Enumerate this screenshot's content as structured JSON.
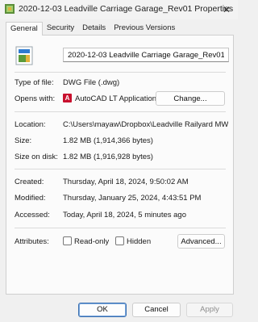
{
  "window": {
    "title": "2020-12-03 Leadville Carriage Garage_Rev01 Properties",
    "close_glyph": "✕"
  },
  "tabs": [
    {
      "label": "General",
      "active": true
    },
    {
      "label": "Security"
    },
    {
      "label": "Details"
    },
    {
      "label": "Previous Versions"
    }
  ],
  "general": {
    "file_name": "2020-12-03 Leadville Carriage Garage_Rev01",
    "type_label": "Type of file:",
    "type_value": "DWG File (.dwg)",
    "opens_label": "Opens with:",
    "opens_value": "AutoCAD LT Application",
    "opens_icon_glyph": "A",
    "change_button": "Change...",
    "location_label": "Location:",
    "location_value": "C:\\Users\\mayaw\\Dropbox\\Leadville Railyard MWK\\C",
    "size_label": "Size:",
    "size_value": "1.82 MB (1,914,366 bytes)",
    "size_disk_label": "Size on disk:",
    "size_disk_value": "1.82 MB (1,916,928 bytes)",
    "created_label": "Created:",
    "created_value": "Thursday, April 18, 2024, 9:50:02 AM",
    "modified_label": "Modified:",
    "modified_value": "Thursday, January 25, 2024, 4:43:51 PM",
    "accessed_label": "Accessed:",
    "accessed_value": "Today, April 18, 2024, 5 minutes ago",
    "attributes_label": "Attributes:",
    "readonly_label": "Read-only",
    "hidden_label": "Hidden",
    "advanced_button": "Advanced..."
  },
  "footer": {
    "ok": "OK",
    "cancel": "Cancel",
    "apply": "Apply"
  },
  "colors": {
    "accent": "#3a6fb0",
    "autocad_red": "#c8102e"
  }
}
